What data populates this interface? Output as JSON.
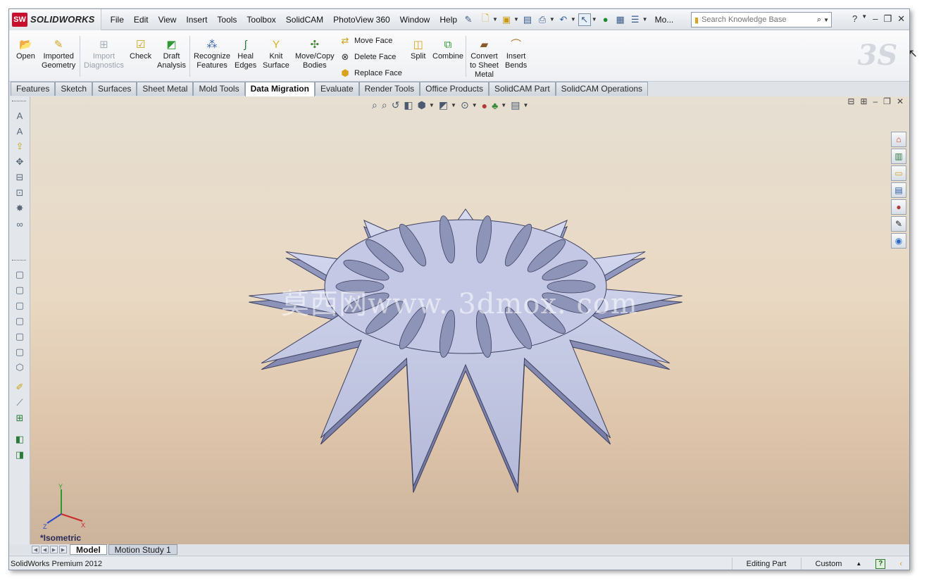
{
  "app": {
    "logo_text": "SOLIDWORKS",
    "menu": [
      "File",
      "Edit",
      "View",
      "Insert",
      "Tools",
      "Toolbox",
      "SolidCAM",
      "PhotoView 360",
      "Window",
      "Help"
    ],
    "overflow_label": "Mo...",
    "search": {
      "placeholder": "Search Knowledge Base"
    }
  },
  "ribbon": {
    "open": "Open",
    "imported_geometry": "Imported\nGeometry",
    "import_diagnostics": "Import\nDiagnostics",
    "check": "Check",
    "draft_analysis": "Draft\nAnalysis",
    "recognize_features": "Recognize\nFeatures",
    "heal_edges": "Heal\nEdges",
    "knit_surface": "Knit\nSurface",
    "move_copy_bodies": "Move/Copy\nBodies",
    "move_face": "Move Face",
    "delete_face": "Delete Face",
    "replace_face": "Replace Face",
    "split": "Split",
    "combine": "Combine",
    "convert_sheet_metal": "Convert\nto Sheet\nMetal",
    "insert_bends": "Insert\nBends"
  },
  "tabs": [
    "Features",
    "Sketch",
    "Surfaces",
    "Sheet Metal",
    "Mold Tools",
    "Data Migration",
    "Evaluate",
    "Render Tools",
    "Office Products",
    "SolidCAM Part",
    "SolidCAM Operations"
  ],
  "active_tab": "Data Migration",
  "viewport": {
    "view_label": "*Isometric",
    "watermark": "莫西网www. 3dmox. com"
  },
  "bottom_tabs": [
    "Model",
    "Motion Study 1"
  ],
  "status": {
    "product": "SolidWorks Premium 2012",
    "mode": "Editing Part",
    "units": "Custom",
    "help": "?"
  },
  "colors": {
    "accent": "#c8102e",
    "viewport_top": "#e6dfd2",
    "viewport_bottom": "#cbb39c",
    "part_fill": "#c9cde6"
  }
}
